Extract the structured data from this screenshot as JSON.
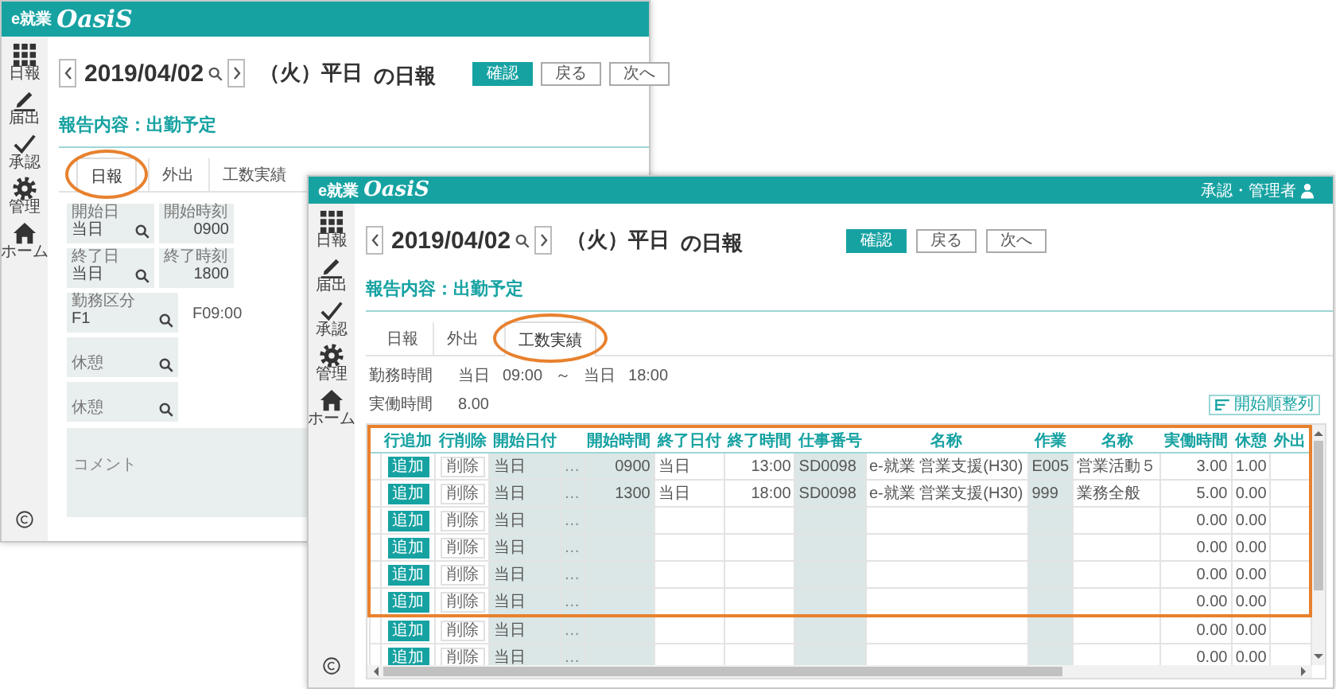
{
  "windows": [
    {
      "logo": {
        "prefix": "e就業",
        "name": "OasiS"
      },
      "sidebar": [
        {
          "label": "日報"
        },
        {
          "label": "届出"
        },
        {
          "label": "承認"
        },
        {
          "label": "管理"
        },
        {
          "label": "ホーム"
        }
      ],
      "date": "2019/04/02",
      "weekday": "（火）平日",
      "title": "の日報",
      "buttons": [
        {
          "label": "確認",
          "primary": true
        },
        {
          "label": "戻る",
          "primary": false
        },
        {
          "label": "次へ",
          "primary": false
        }
      ],
      "section_title": "報告内容：出勤予定",
      "tabs": [
        {
          "label": "日報",
          "selected": true,
          "circled": true
        },
        {
          "label": "外出",
          "selected": false,
          "circled": false
        },
        {
          "label": "工数実績",
          "selected": false,
          "circled": false
        }
      ],
      "content": {
        "kind": "form",
        "field_rows": [
          [
            {
              "kind": "lookup",
              "label": "開始日",
              "value": "当日"
            },
            {
              "kind": "time",
              "label": "開始時刻",
              "value": "0900"
            }
          ],
          [
            {
              "kind": "lookup",
              "label": "終了日",
              "value": "当日"
            },
            {
              "kind": "time",
              "label": "終了時刻",
              "value": "1800"
            }
          ],
          [
            {
              "kind": "lookup",
              "label": "勤務区分",
              "value": "F1",
              "note": "F09:00"
            }
          ],
          [
            {
              "kind": "lookup",
              "placeholder": "休憩"
            }
          ],
          [
            {
              "kind": "lookup",
              "placeholder": "休憩"
            }
          ]
        ],
        "comment": {
          "placeholder": "コメント"
        }
      }
    },
    {
      "logo": {
        "prefix": "e就業",
        "name": "OasiS"
      },
      "user": "承認・管理者",
      "sidebar": [
        {
          "label": "日報"
        },
        {
          "label": "届出"
        },
        {
          "label": "承認"
        },
        {
          "label": "管理"
        },
        {
          "label": "ホーム"
        }
      ],
      "date": "2019/04/02",
      "weekday": "（火）平日",
      "title": "の日報",
      "buttons": [
        {
          "label": "確認",
          "primary": true
        },
        {
          "label": "戻る",
          "primary": false
        },
        {
          "label": "次へ",
          "primary": false
        }
      ],
      "section_title": "報告内容：出勤予定",
      "tabs": [
        {
          "label": "日報",
          "selected": false,
          "circled": false
        },
        {
          "label": "外出",
          "selected": false,
          "circled": false
        },
        {
          "label": "工数実績",
          "selected": true,
          "circled": true
        }
      ],
      "content": {
        "kind": "table",
        "work_hours": {
          "label": "勤務時間",
          "start_day": "当日",
          "start": "09:00",
          "separator": "～",
          "end_day": "当日",
          "end": "18:00"
        },
        "actual": {
          "label": "実働時間",
          "value": "8.00"
        },
        "sort_button": "開始順整列",
        "columns": [
          {
            "label": "行追加",
            "kind": "add",
            "shaded": false
          },
          {
            "label": "行削除",
            "kind": "delete",
            "shaded": false
          },
          {
            "label": "開始日付",
            "kind": "text",
            "shaded": true
          },
          {
            "kind": "dots",
            "shaded": true
          },
          {
            "label": "開始時間",
            "kind": "number",
            "shaded": true
          },
          {
            "label": "終了日付",
            "kind": "text",
            "shaded": false
          },
          {
            "label": "終了時間",
            "kind": "number",
            "shaded": false
          },
          {
            "label": "仕事番号",
            "kind": "text",
            "shaded": true
          },
          {
            "label": "名称",
            "kind": "text",
            "shaded": false
          },
          {
            "label": "作業",
            "kind": "text",
            "shaded": true
          },
          {
            "label": "名称",
            "kind": "text",
            "shaded": false
          },
          {
            "label": "実働時間",
            "kind": "number",
            "shaded": false
          },
          {
            "label": "休憩",
            "kind": "number",
            "shaded": false
          },
          {
            "label": "外出",
            "kind": "number",
            "shaded": false
          }
        ],
        "rows": [
          {
            "framed": true,
            "add": "追加",
            "delete": "削除",
            "start_day": "当日",
            "dots": "…",
            "start_time": "0900",
            "end_day": "当日",
            "end_time": "13:00",
            "job_no": "SD0098",
            "job_name": "e-就業 営業支援(H30)",
            "task": "E005",
            "task_name": "営業活動５",
            "hours": "3.00",
            "break": "1.00"
          },
          {
            "framed": true,
            "add": "追加",
            "delete": "削除",
            "start_day": "当日",
            "dots": "…",
            "start_time": "1300",
            "end_day": "当日",
            "end_time": "18:00",
            "job_no": "SD0098",
            "job_name": "e-就業 営業支援(H30)",
            "task": "999",
            "task_name": "業務全般",
            "hours": "5.00",
            "break": "0.00"
          },
          {
            "framed": true,
            "add": "追加",
            "delete": "削除",
            "start_day": "当日",
            "dots": "…",
            "hours": "0.00",
            "break": "0.00"
          },
          {
            "framed": true,
            "add": "追加",
            "delete": "削除",
            "start_day": "当日",
            "dots": "…",
            "hours": "0.00",
            "break": "0.00"
          },
          {
            "framed": true,
            "add": "追加",
            "delete": "削除",
            "start_day": "当日",
            "dots": "…",
            "hours": "0.00",
            "break": "0.00"
          },
          {
            "framed": true,
            "add": "追加",
            "delete": "削除",
            "start_day": "当日",
            "dots": "…",
            "hours": "0.00",
            "break": "0.00"
          },
          {
            "framed": false,
            "add": "追加",
            "delete": "削除",
            "start_day": "当日",
            "dots": "…",
            "hours": "0.00",
            "break": "0.00"
          },
          {
            "framed": false,
            "add": "追加",
            "delete": "削除",
            "start_day": "当日",
            "dots": "…",
            "hours": "0.00",
            "break": "0.00"
          }
        ]
      }
    }
  ]
}
